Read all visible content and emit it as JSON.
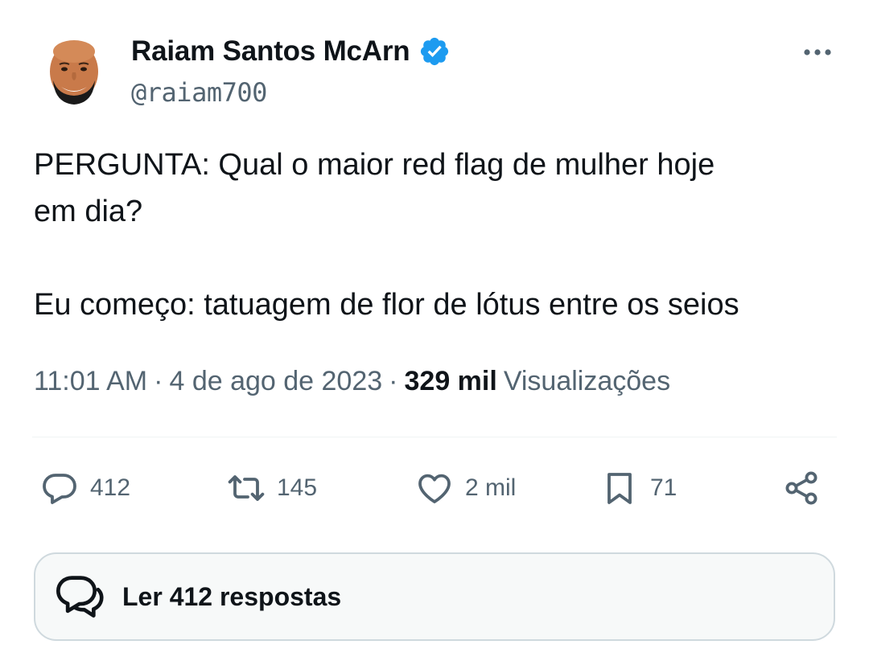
{
  "author": {
    "display_name": "Raiam Santos McArn",
    "handle": "@raiam700",
    "verified": true,
    "avatar_icon": "cartoon-face-avatar"
  },
  "tweet": {
    "text": "PERGUNTA: Qual o maior red flag de mulher hoje\nem dia?\n\nEu começo: tatuagem de flor de lótus entre os seios"
  },
  "meta": {
    "time": "11:01 AM",
    "separator": "·",
    "date": "4 de ago de 2023",
    "views_count": "329 mil",
    "views_label": "Visualizações"
  },
  "actions": {
    "replies": "412",
    "retweets": "145",
    "likes": "2 mil",
    "bookmarks": "71"
  },
  "read_replies": {
    "label": "Ler 412 respostas"
  },
  "colors": {
    "text_primary": "#0f1419",
    "text_secondary": "#536471",
    "verified_blue": "#1d9bf0",
    "border": "#cfd9de"
  }
}
